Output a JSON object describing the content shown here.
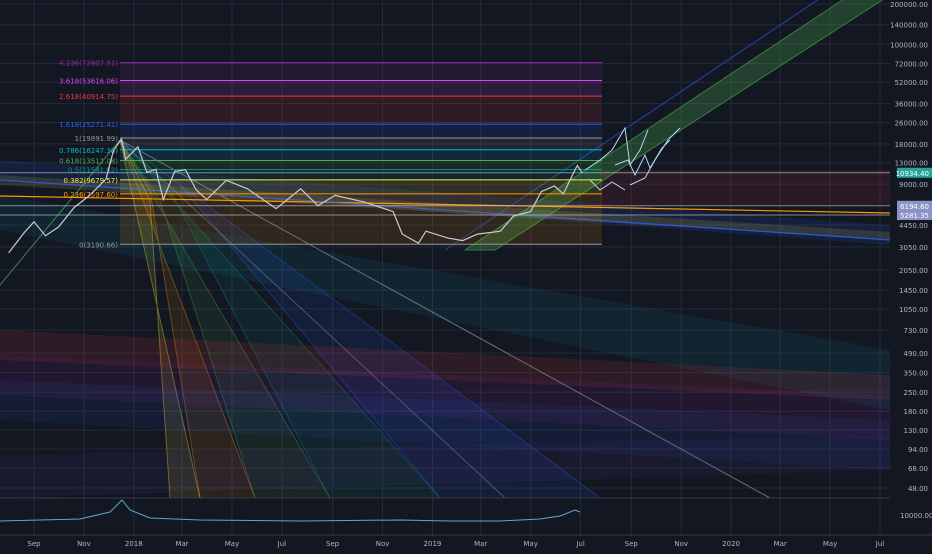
{
  "chart_data": {
    "type": "line",
    "scale": "log",
    "grid": true,
    "colors": {
      "background": "#131722",
      "grid": "#262a36",
      "price_line": "#c8cbd3",
      "axis_text": "#b2b5be",
      "last_price_bg": "#26a69a",
      "level_tag_bg": "#8b93c7"
    },
    "y_axis": {
      "ticks": [
        {
          "label": "200000.00",
          "value": 200000
        },
        {
          "label": "140000.00",
          "value": 140000
        },
        {
          "label": "100000.00",
          "value": 100000
        },
        {
          "label": "72000.00",
          "value": 72000
        },
        {
          "label": "52000.00",
          "value": 52000
        },
        {
          "label": "36000.00",
          "value": 36000
        },
        {
          "label": "26000.00",
          "value": 26000
        },
        {
          "label": "18000.00",
          "value": 18000
        },
        {
          "label": "13000.00",
          "value": 13000
        },
        {
          "label": "9000.00",
          "value": 9000
        },
        {
          "label": "4450.00",
          "value": 4450
        },
        {
          "label": "3050.00",
          "value": 3050
        },
        {
          "label": "2050.00",
          "value": 2050
        },
        {
          "label": "1450.00",
          "value": 1450
        },
        {
          "label": "1050.00",
          "value": 1050
        },
        {
          "label": "730.00",
          "value": 730
        },
        {
          "label": "490.00",
          "value": 490
        },
        {
          "label": "350.00",
          "value": 350
        },
        {
          "label": "250.00",
          "value": 250
        },
        {
          "label": "180.00",
          "value": 180
        },
        {
          "label": "130.00",
          "value": 130
        },
        {
          "label": "94.00",
          "value": 94
        },
        {
          "label": "68.00",
          "value": 68
        },
        {
          "label": "48.00",
          "value": 48
        }
      ],
      "price_tags": [
        {
          "label": "10934.40",
          "value": 10934.4,
          "kind": "last"
        },
        {
          "label": "6194.60",
          "value": 6194.6,
          "kind": "level"
        },
        {
          "label": "5281.35",
          "value": 5281.35,
          "kind": "level"
        }
      ]
    },
    "x_axis": {
      "ticks": [
        {
          "label": "Sep",
          "date": "2017-09-01"
        },
        {
          "label": "Nov",
          "date": "2017-11-01"
        },
        {
          "label": "2018",
          "date": "2018-01-01"
        },
        {
          "label": "Mar",
          "date": "2018-03-01"
        },
        {
          "label": "May",
          "date": "2018-05-01"
        },
        {
          "label": "Jul",
          "date": "2018-07-01"
        },
        {
          "label": "Sep",
          "date": "2018-09-01"
        },
        {
          "label": "Nov",
          "date": "2018-11-01"
        },
        {
          "label": "2019",
          "date": "2019-01-01"
        },
        {
          "label": "Mar",
          "date": "2019-03-01"
        },
        {
          "label": "May",
          "date": "2019-05-01"
        },
        {
          "label": "Jul",
          "date": "2019-07-01"
        },
        {
          "label": "Sep",
          "date": "2019-09-01"
        },
        {
          "label": "Nov",
          "date": "2019-11-01"
        },
        {
          "label": "2020",
          "date": "2020-01-01"
        },
        {
          "label": "Mar",
          "date": "2020-03-01"
        },
        {
          "label": "May",
          "date": "2020-05-01"
        },
        {
          "label": "Jul",
          "date": "2020-07-01"
        }
      ]
    },
    "fib_levels": [
      {
        "label": "4.236(72807.51)",
        "value": 72807.51,
        "color": "#9c27b0"
      },
      {
        "label": "3.618(53616.06)",
        "value": 53616.06,
        "color": "#e040fb"
      },
      {
        "label": "2.618(40914.75)",
        "value": 40914.75,
        "color": "#f23645"
      },
      {
        "label": "1.618(25271.41)",
        "value": 25271.41,
        "color": "#2962ff"
      },
      {
        "label": "1(19891.99)",
        "value": 19891.99,
        "color": "#9598a1"
      },
      {
        "label": "0.786(16247.38)",
        "value": 16247.38,
        "color": "#00bcd4"
      },
      {
        "label": "0.618(13512.08)",
        "value": 13512.08,
        "color": "#4caf50"
      },
      {
        "label": "0.5(11541.52)",
        "value": 11541.52,
        "color": "#089981"
      },
      {
        "label": "0.382(9679.57)",
        "value": 9679.57,
        "color": "#ffeb3b"
      },
      {
        "label": "0.236(7597.60)",
        "value": 7597.6,
        "color": "#ff9800"
      },
      {
        "label": "0(3190.66)",
        "value": 3190.66,
        "color": "#9598a1"
      }
    ],
    "series": [
      {
        "values": [
          {
            "x": "2017-08-01",
            "y": 2750
          },
          {
            "x": "2017-08-20",
            "y": 3900
          },
          {
            "x": "2017-09-01",
            "y": 4700
          },
          {
            "x": "2017-09-15",
            "y": 3700
          },
          {
            "x": "2017-10-01",
            "y": 4300
          },
          {
            "x": "2017-10-20",
            "y": 6000
          },
          {
            "x": "2017-11-08",
            "y": 7400
          },
          {
            "x": "2017-11-28",
            "y": 9800
          },
          {
            "x": "2017-12-07",
            "y": 16000
          },
          {
            "x": "2017-12-17",
            "y": 19600
          },
          {
            "x": "2017-12-22",
            "y": 13800
          },
          {
            "x": "2018-01-06",
            "y": 17100
          },
          {
            "x": "2018-01-17",
            "y": 11000
          },
          {
            "x": "2018-01-28",
            "y": 11600
          },
          {
            "x": "2018-02-06",
            "y": 6900
          },
          {
            "x": "2018-02-20",
            "y": 11200
          },
          {
            "x": "2018-03-05",
            "y": 11500
          },
          {
            "x": "2018-03-18",
            "y": 8200
          },
          {
            "x": "2018-03-31",
            "y": 6900
          },
          {
            "x": "2018-04-24",
            "y": 9600
          },
          {
            "x": "2018-05-20",
            "y": 8300
          },
          {
            "x": "2018-06-24",
            "y": 5900
          },
          {
            "x": "2018-07-24",
            "y": 8300
          },
          {
            "x": "2018-08-14",
            "y": 6200
          },
          {
            "x": "2018-09-04",
            "y": 7400
          },
          {
            "x": "2018-10-10",
            "y": 6600
          },
          {
            "x": "2018-11-14",
            "y": 5600
          },
          {
            "x": "2018-11-25",
            "y": 3800
          },
          {
            "x": "2018-12-15",
            "y": 3250
          },
          {
            "x": "2018-12-24",
            "y": 4000
          },
          {
            "x": "2019-01-20",
            "y": 3550
          },
          {
            "x": "2019-02-07",
            "y": 3400
          },
          {
            "x": "2019-02-25",
            "y": 3800
          },
          {
            "x": "2019-03-25",
            "y": 4000
          },
          {
            "x": "2019-04-10",
            "y": 5200
          },
          {
            "x": "2019-05-01",
            "y": 5600
          },
          {
            "x": "2019-05-14",
            "y": 7900
          },
          {
            "x": "2019-05-30",
            "y": 8700
          },
          {
            "x": "2019-06-10",
            "y": 7600
          },
          {
            "x": "2019-06-22",
            "y": 10800
          },
          {
            "x": "2019-06-27",
            "y": 12400
          },
          {
            "x": "2019-07-03",
            "y": 10934.4
          }
        ]
      }
    ]
  }
}
